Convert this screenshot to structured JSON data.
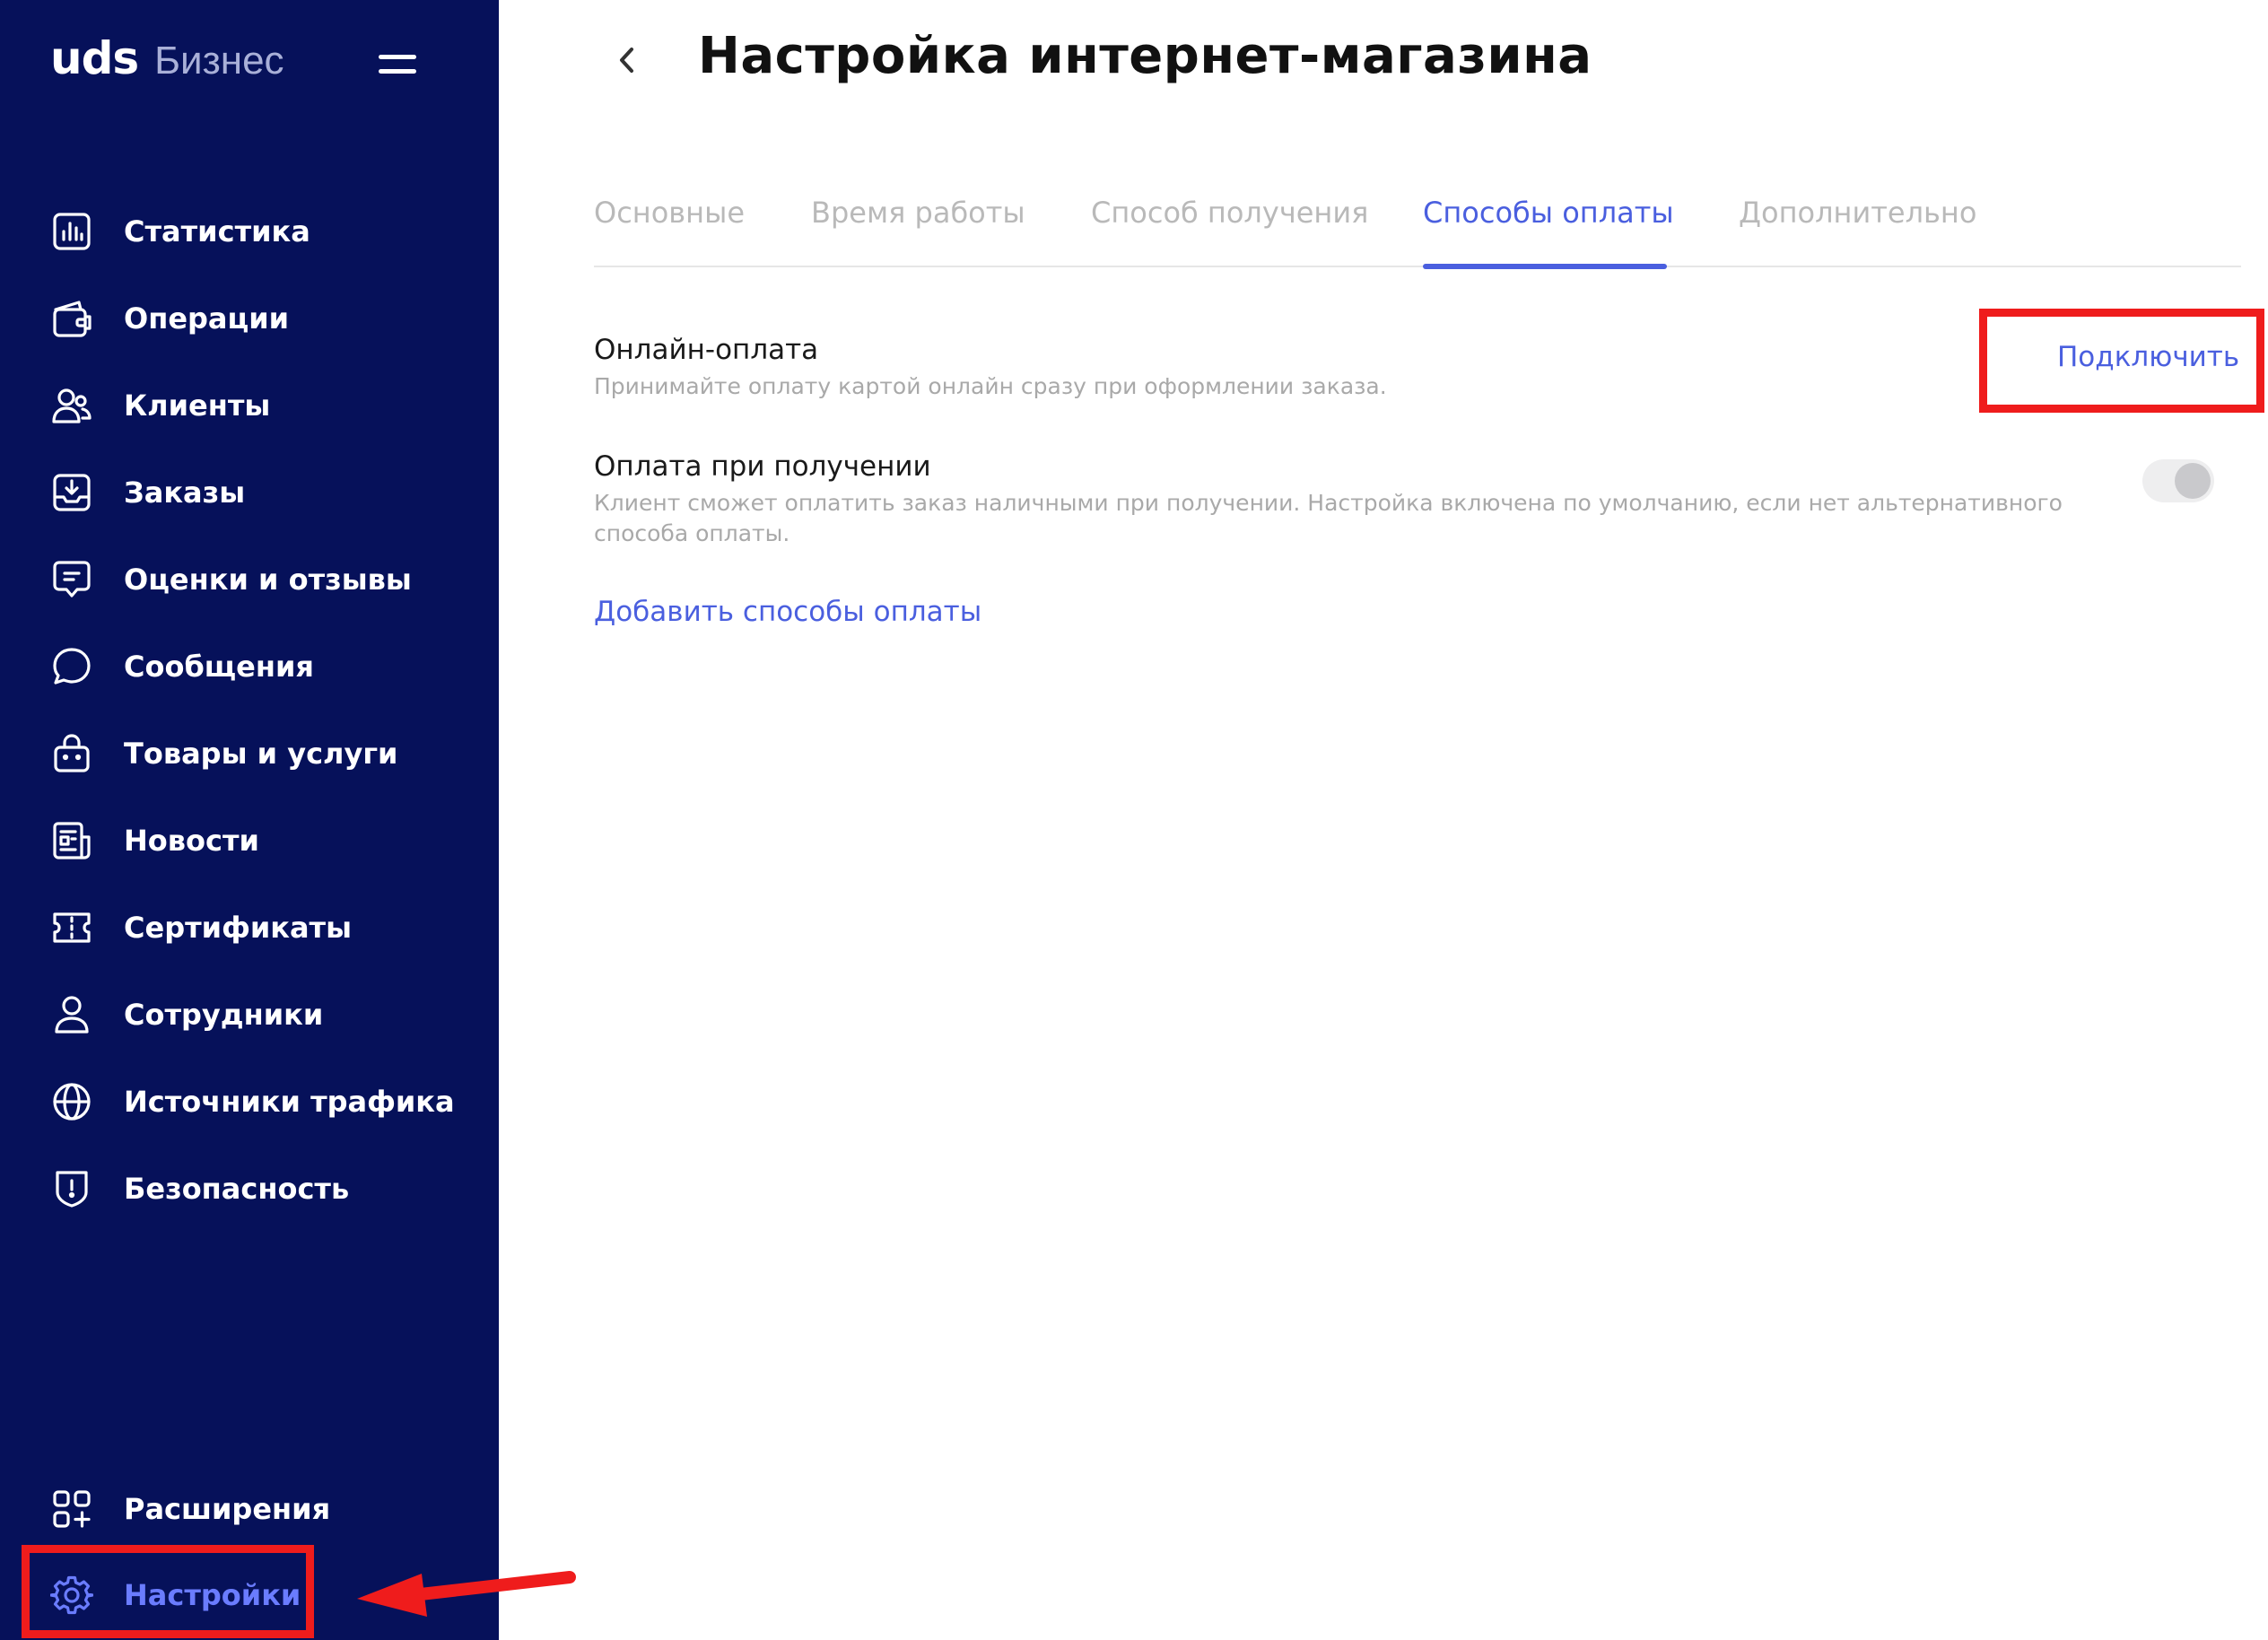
{
  "sidebar": {
    "logo_main": "uds",
    "logo_sub": "Бизнес",
    "menu_icon": "hamburger-icon",
    "items": [
      {
        "label": "Статистика",
        "icon": "chart-icon"
      },
      {
        "label": "Операции",
        "icon": "wallet-icon"
      },
      {
        "label": "Клиенты",
        "icon": "users-icon"
      },
      {
        "label": "Заказы",
        "icon": "inbox-icon"
      },
      {
        "label": "Оценки и отзывы",
        "icon": "review-icon"
      },
      {
        "label": "Сообщения",
        "icon": "chat-icon"
      },
      {
        "label": "Товары и услуги",
        "icon": "bag-icon"
      },
      {
        "label": "Новости",
        "icon": "news-icon"
      },
      {
        "label": "Сертификаты",
        "icon": "ticket-icon"
      },
      {
        "label": "Сотрудники",
        "icon": "user-icon"
      },
      {
        "label": "Источники трафика",
        "icon": "globe-icon"
      },
      {
        "label": "Безопасность",
        "icon": "shield-icon"
      }
    ],
    "bottom_items": [
      {
        "label": "Расширения",
        "icon": "extensions-icon"
      },
      {
        "label": "Настройки",
        "icon": "gear-icon",
        "active": true
      }
    ]
  },
  "header": {
    "title": "Настройка интернет-магазина",
    "back_icon": "chevron-left-icon"
  },
  "tabs": [
    {
      "label": "Основные",
      "active": false
    },
    {
      "label": "Время работы",
      "active": false
    },
    {
      "label": "Способ получения",
      "active": false
    },
    {
      "label": "Способы оплаты",
      "active": true
    },
    {
      "label": "Дополнительно",
      "active": false
    }
  ],
  "payment": {
    "online": {
      "title": "Онлайн-оплата",
      "description": "Принимайте оплату картой онлайн сразу при оформлении заказа.",
      "action_label": "Подключить"
    },
    "on_delivery": {
      "title": "Оплата при получении",
      "description": "Клиент сможет оплатить заказ наличными при получении. Настройка включена по умолчанию, если нет альтернативного способа оплаты.",
      "toggle_enabled": false
    },
    "add_link": "Добавить способы оплаты"
  },
  "colors": {
    "sidebar_bg": "#06115a",
    "accent": "#4a5fdf",
    "highlight": "#ef1c1c",
    "muted_text": "#a9a9a9"
  }
}
